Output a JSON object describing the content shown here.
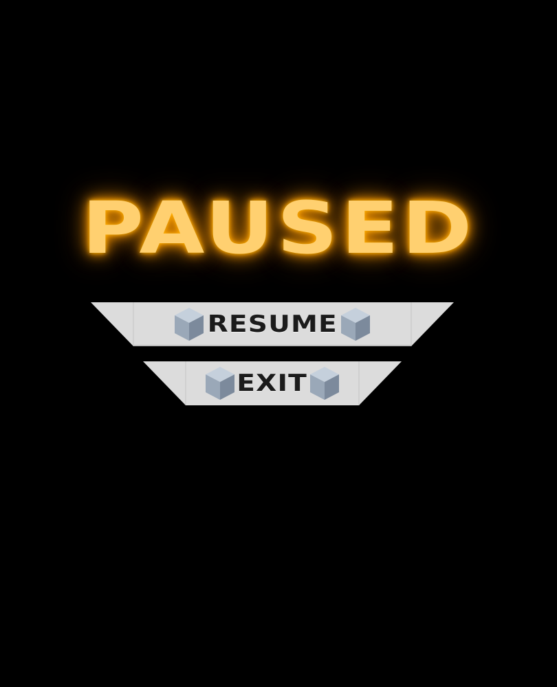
{
  "pause_menu": {
    "title": "PAUSED",
    "buttons": [
      {
        "label": "RESUME",
        "icon": "cube-icon"
      },
      {
        "label": "EXIT",
        "icon": "cube-icon"
      }
    ]
  },
  "colors": {
    "background": "#000000",
    "title_glow": "#ffb300",
    "title_text": "#ffd070",
    "button_fill": "#dcdcdc",
    "button_text": "#1b1b1b",
    "cube_top": "#c5d0dc",
    "cube_left": "#9aa8b8",
    "cube_right": "#7c8a9c"
  }
}
